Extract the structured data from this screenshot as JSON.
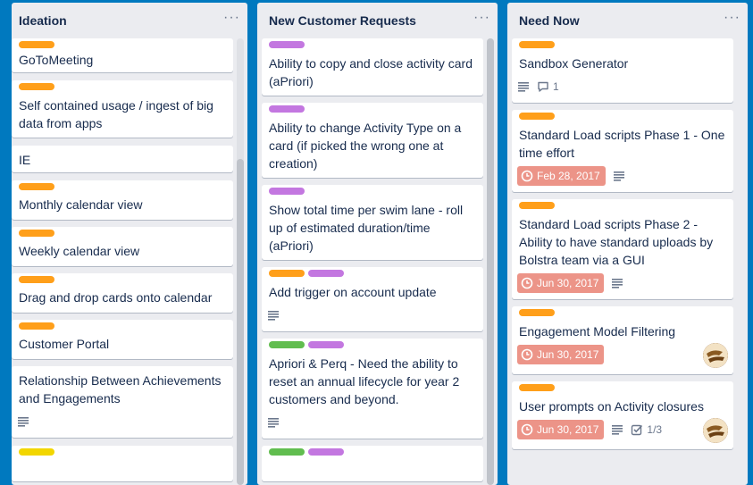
{
  "colors": {
    "board_bg": "#0079bf",
    "label_orange": "#ff9f1a",
    "label_purple": "#c377e0",
    "label_green": "#61bd4f",
    "label_yellow": "#f2d600",
    "due_overdue": "#ec9488"
  },
  "lists": [
    {
      "title": "Ideation",
      "menu": "···",
      "cards": [
        {
          "title": "GoToMeeting"
        },
        {
          "title": "Self contained usage / ingest of big data from apps"
        },
        {
          "title": "IE"
        },
        {
          "title": "Monthly calendar view"
        },
        {
          "title": "Weekly calendar view"
        },
        {
          "title": "Drag and drop cards onto calendar"
        },
        {
          "title": "Customer Portal"
        },
        {
          "title": "Relationship Between Achievements and Engagements"
        }
      ]
    },
    {
      "title": "New Customer Requests",
      "menu": "···",
      "cards": [
        {
          "title": "Ability to copy and close activity card (aPriori)"
        },
        {
          "title": "Ability to change Activity Type on a card (if picked the wrong one at creation)"
        },
        {
          "title": "Show total time per swim lane - roll up of estimated duration/time (aPriori)"
        },
        {
          "title": "Add trigger on account update"
        },
        {
          "title": "Apriori & Perq - Need the ability to reset an annual lifecycle for year 2 customers and beyond."
        }
      ]
    },
    {
      "title": "Need Now",
      "menu": "···",
      "cards": [
        {
          "title": "Sandbox Generator",
          "comments": "1"
        },
        {
          "title": "Standard Load scripts Phase 1 - One time effort",
          "due": "Feb 28, 2017"
        },
        {
          "title": "Standard Load scripts Phase 2 - Ability to have standard uploads by Bolstra team via a GUI",
          "due": "Jun 30, 2017"
        },
        {
          "title": "Engagement Model Filtering",
          "due": "Jun 30, 2017"
        },
        {
          "title": "User prompts on Activity closures",
          "due": "Jun 30, 2017",
          "checklist": "1/3"
        }
      ]
    }
  ]
}
